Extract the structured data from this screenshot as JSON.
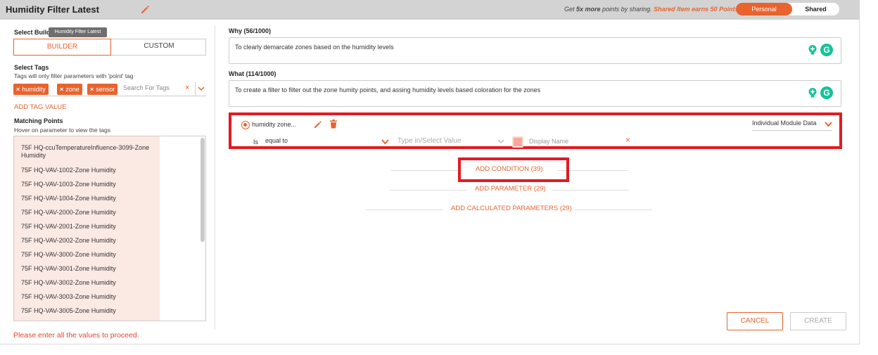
{
  "header": {
    "title": "Humidity Filter Latest",
    "promo_prefix": "Get ",
    "promo_bold": "5x more",
    "promo_mid": " points by sharing. ",
    "promo_accent": "Shared Item earns 50 Points.",
    "toggle_on": "Personal",
    "toggle_off": "Shared"
  },
  "left": {
    "select_build_label": "Select Build",
    "tooltip": "Humidity Filter Latest",
    "builder_label": "BUILDER",
    "custom_label": "CUSTOM",
    "select_tags_label": "Select Tags",
    "tags_hint": "Tags will only filter parameters with 'point' tag",
    "tags": [
      "humidity",
      "zone",
      "sensor"
    ],
    "tag_search_placeholder": "Search For Tags",
    "add_tag_value": "ADD TAG VALUE",
    "matching_points_label": "Matching Points",
    "matching_points_hint": "Hover on parameter to view the tags",
    "points": [
      "75F HQ-ccuTemperatureInfluence-3099-Zone Humidity",
      "75F HQ-VAV-1002-Zone Humidity",
      "75F HQ-VAV-1003-Zone Humidity",
      "75F HQ-VAV-1004-Zone Humidity",
      "75F HQ-VAV-2000-Zone Humidity",
      "75F HQ-VAV-2001-Zone Humidity",
      "75F HQ-VAV-2002-Zone Humidity",
      "75F HQ-VAV-3000-Zone Humidity",
      "75F HQ-VAV-3001-Zone Humidity",
      "75F HQ-VAV-3002-Zone Humidity",
      "75F HQ-VAV-3003-Zone Humidity",
      "75F HQ-VAV-3005-Zone Humidity"
    ],
    "error": "Please enter all the values to proceed."
  },
  "right": {
    "why_label": "Why (56/1000)",
    "why_text": "To  clearly demarcate zones based on the humidity levels",
    "what_label": "What (114/1000)",
    "what_text": "To create a filter to filter out the zone humity points, and assing humidity levels based coloration for the zones",
    "grammarly_letter": "G",
    "condition": {
      "name": "humidity zone...",
      "module": "Individual Module Data",
      "is_label": "Is",
      "operator": "equal to",
      "value_placeholder": "Type in/Select Value",
      "display_name_placeholder": "Display Name",
      "swatch_color": "#f5a99b"
    },
    "add_condition": "ADD CONDITION (39)",
    "add_parameter": "ADD PARAMETER (29)",
    "add_calculated": "ADD CALCULATED PARAMETERS (29)",
    "cancel": "CANCEL",
    "create": "CREATE"
  },
  "colors": {
    "accent": "#e8632e",
    "highlight": "#e21b22",
    "grammarly": "#15c39a"
  }
}
